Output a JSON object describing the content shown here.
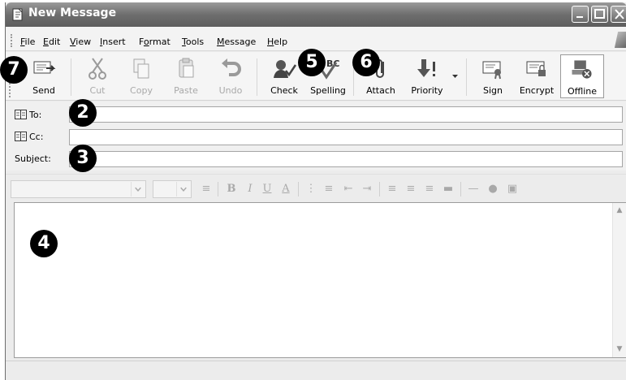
{
  "window": {
    "title": "New Message"
  },
  "menu": [
    {
      "label": "File",
      "mnemonic": "F"
    },
    {
      "label": "Edit",
      "mnemonic": "E"
    },
    {
      "label": "View",
      "mnemonic": "V"
    },
    {
      "label": "Insert",
      "mnemonic": "I"
    },
    {
      "label": "Format",
      "mnemonic": "o"
    },
    {
      "label": "Tools",
      "mnemonic": "T"
    },
    {
      "label": "Message",
      "mnemonic": "M"
    },
    {
      "label": "Help",
      "mnemonic": "H"
    }
  ],
  "toolbar": {
    "send": "Send",
    "cut": "Cut",
    "copy": "Copy",
    "paste": "Paste",
    "undo": "Undo",
    "check": "Check",
    "spelling": "Spelling",
    "attach": "Attach",
    "priority": "Priority",
    "sign": "Sign",
    "encrypt": "Encrypt",
    "offline": "Offline"
  },
  "fields": {
    "to_label": "To:",
    "cc_label": "Cc:",
    "subject_label": "Subject:",
    "to_value": "",
    "cc_value": "",
    "subject_value": ""
  },
  "callouts": {
    "c2": "2",
    "c3": "3",
    "c4": "4",
    "c5": "5",
    "c6": "6",
    "c7": "7"
  },
  "icons": [
    "send-icon",
    "cut-icon",
    "copy-icon",
    "paste-icon",
    "undo-icon",
    "check-icon",
    "spelling-icon",
    "attach-icon",
    "priority-icon",
    "sign-icon",
    "encrypt-icon",
    "offline-icon",
    "address-book-icon"
  ]
}
